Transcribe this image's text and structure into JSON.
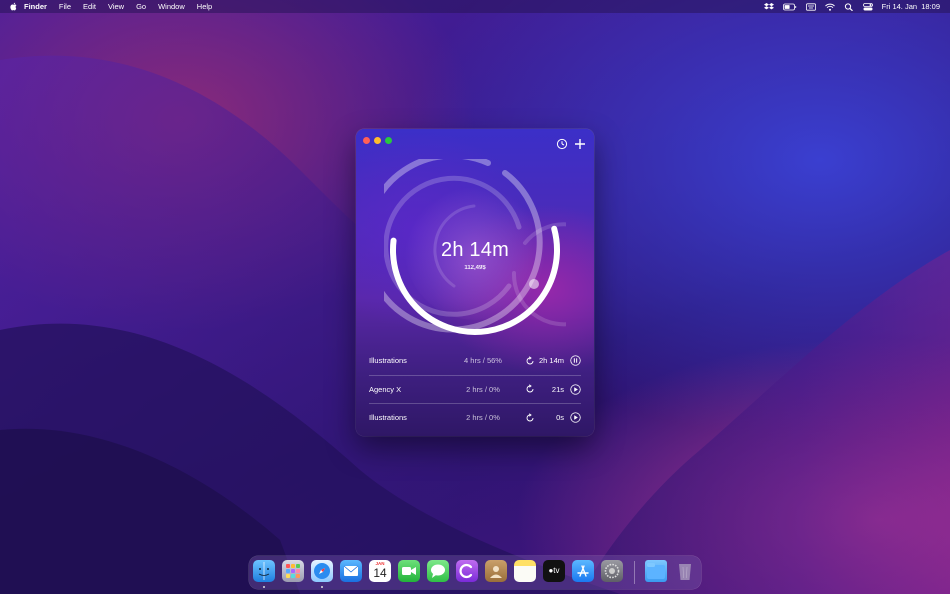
{
  "menubar": {
    "app_name": "Finder",
    "menus": [
      "File",
      "Edit",
      "View",
      "Go",
      "Window",
      "Help"
    ],
    "clock": "Fri 14. Jan  18:09",
    "status_icons": [
      "dropbox-icon",
      "battery-icon",
      "keyboard-icon",
      "wifi-icon",
      "spotlight-icon",
      "control-center-icon"
    ]
  },
  "timer_window": {
    "traffic_lights": [
      "close",
      "minimize",
      "zoom"
    ],
    "toolbar_icons": [
      "timer-settings-icon",
      "add-icon"
    ],
    "total_time": "2h 14m",
    "earnings": "112,49$",
    "progress_fraction": 0.56,
    "rows": [
      {
        "name": "Illustrations",
        "goal": "4 hrs / 56%",
        "elapsed": "2h 14m",
        "state": "pause-icon"
      },
      {
        "name": "Agency X",
        "goal": "2 hrs / 0%",
        "elapsed": "21s",
        "state": "play-icon"
      },
      {
        "name": "Illustrations",
        "goal": "2 hrs / 0%",
        "elapsed": "0s",
        "state": "play-icon"
      }
    ]
  },
  "dock": {
    "apps": [
      "Finder",
      "Launchpad",
      "Safari",
      "Mail",
      "Calendar",
      "FaceTime",
      "Messages",
      "Timer App",
      "Contacts",
      "Notes",
      "Apple TV",
      "App Store",
      "System Preferences",
      "Downloads",
      "Trash"
    ],
    "calendar_month": "JAN",
    "calendar_day": "14"
  }
}
